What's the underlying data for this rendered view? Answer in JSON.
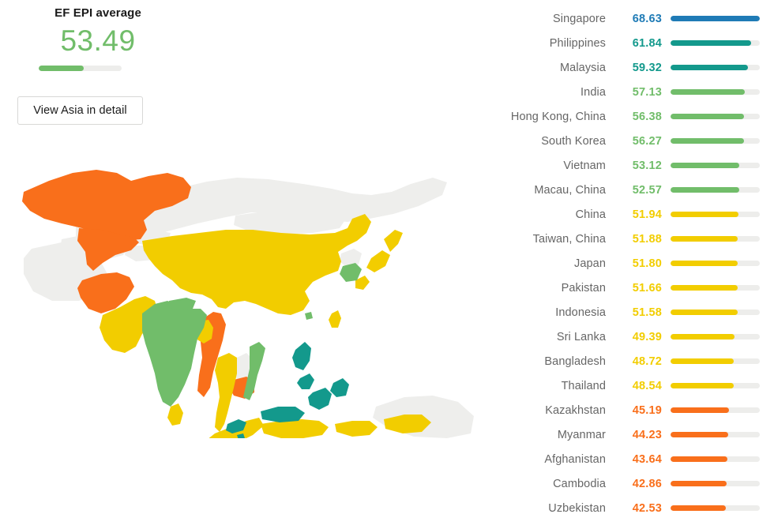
{
  "summary": {
    "title": "EF EPI average",
    "value": "53.49",
    "value_number": 53.49,
    "bar_percent": 54,
    "color": "#71bd6a"
  },
  "actions": {
    "view_detail_label": "View Asia in detail"
  },
  "palette": {
    "very_high": "#1f7bb6",
    "high": "#13998c",
    "moderate": "#71bd6a",
    "low": "#f2cd00",
    "very_low": "#f96f1b",
    "track": "#ededeb",
    "map_no_data": "#eeeeec",
    "label": "#666666"
  },
  "chart_data": {
    "type": "bar",
    "title": "EF EPI average",
    "xlabel": "",
    "ylabel": "",
    "orientation": "horizontal",
    "grid": false,
    "legend_position": "none",
    "xlim": [
      0,
      68.63
    ],
    "region": "Asia",
    "average": 53.49,
    "categories": [
      "Singapore",
      "Philippines",
      "Malaysia",
      "India",
      "Hong Kong, China",
      "South Korea",
      "Vietnam",
      "Macau, China",
      "China",
      "Taiwan, China",
      "Japan",
      "Pakistan",
      "Indonesia",
      "Sri Lanka",
      "Bangladesh",
      "Thailand",
      "Kazakhstan",
      "Myanmar",
      "Afghanistan",
      "Cambodia",
      "Uzbekistan"
    ],
    "values": [
      68.63,
      61.84,
      59.32,
      57.13,
      56.38,
      56.27,
      53.12,
      52.57,
      51.94,
      51.88,
      51.8,
      51.66,
      51.58,
      49.39,
      48.72,
      48.54,
      45.19,
      44.23,
      43.64,
      42.86,
      42.53
    ],
    "bands": [
      "very_high",
      "high",
      "high",
      "moderate",
      "moderate",
      "moderate",
      "moderate",
      "moderate",
      "low",
      "low",
      "low",
      "low",
      "low",
      "low",
      "low",
      "low",
      "very_low",
      "very_low",
      "very_low",
      "very_low",
      "very_low"
    ]
  },
  "rows": [
    {
      "country": "Singapore",
      "value": "68.63",
      "number": 68.63,
      "color": "#1f7bb6",
      "percent": 100.0
    },
    {
      "country": "Philippines",
      "value": "61.84",
      "number": 61.84,
      "color": "#13998c",
      "percent": 90.1
    },
    {
      "country": "Malaysia",
      "value": "59.32",
      "number": 59.32,
      "color": "#13998c",
      "percent": 86.4
    },
    {
      "country": "India",
      "value": "57.13",
      "number": 57.13,
      "color": "#71bd6a",
      "percent": 83.2
    },
    {
      "country": "Hong Kong, China",
      "value": "56.38",
      "number": 56.38,
      "color": "#71bd6a",
      "percent": 82.1
    },
    {
      "country": "South Korea",
      "value": "56.27",
      "number": 56.27,
      "color": "#71bd6a",
      "percent": 82.0
    },
    {
      "country": "Vietnam",
      "value": "53.12",
      "number": 53.12,
      "color": "#71bd6a",
      "percent": 77.4
    },
    {
      "country": "Macau, China",
      "value": "52.57",
      "number": 52.57,
      "color": "#71bd6a",
      "percent": 76.6
    },
    {
      "country": "China",
      "value": "51.94",
      "number": 51.94,
      "color": "#f2cd00",
      "percent": 75.7
    },
    {
      "country": "Taiwan, China",
      "value": "51.88",
      "number": 51.88,
      "color": "#f2cd00",
      "percent": 75.6
    },
    {
      "country": "Japan",
      "value": "51.80",
      "number": 51.8,
      "color": "#f2cd00",
      "percent": 75.5
    },
    {
      "country": "Pakistan",
      "value": "51.66",
      "number": 51.66,
      "color": "#f2cd00",
      "percent": 75.3
    },
    {
      "country": "Indonesia",
      "value": "51.58",
      "number": 51.58,
      "color": "#f2cd00",
      "percent": 75.2
    },
    {
      "country": "Sri Lanka",
      "value": "49.39",
      "number": 49.39,
      "color": "#f2cd00",
      "percent": 72.0
    },
    {
      "country": "Bangladesh",
      "value": "48.72",
      "number": 48.72,
      "color": "#f2cd00",
      "percent": 71.0
    },
    {
      "country": "Thailand",
      "value": "48.54",
      "number": 48.54,
      "color": "#f2cd00",
      "percent": 70.7
    },
    {
      "country": "Kazakhstan",
      "value": "45.19",
      "number": 45.19,
      "color": "#f96f1b",
      "percent": 65.8
    },
    {
      "country": "Myanmar",
      "value": "44.23",
      "number": 44.23,
      "color": "#f96f1b",
      "percent": 64.4
    },
    {
      "country": "Afghanistan",
      "value": "43.64",
      "number": 43.64,
      "color": "#f96f1b",
      "percent": 63.6
    },
    {
      "country": "Cambodia",
      "value": "42.86",
      "number": 42.86,
      "color": "#f96f1b",
      "percent": 62.4
    },
    {
      "country": "Uzbekistan",
      "value": "42.53",
      "number": 42.53,
      "color": "#f96f1b",
      "percent": 62.0
    }
  ],
  "map": {
    "name": "asia-choropleth-map",
    "regions": [
      {
        "name": "kazakhstan",
        "color": "#f96f1b"
      },
      {
        "name": "uzbekistan",
        "color": "#f96f1b"
      },
      {
        "name": "afghanistan",
        "color": "#f96f1b"
      },
      {
        "name": "pakistan",
        "color": "#f2cd00"
      },
      {
        "name": "india",
        "color": "#71bd6a"
      },
      {
        "name": "sri-lanka",
        "color": "#f2cd00"
      },
      {
        "name": "bangladesh",
        "color": "#f2cd00"
      },
      {
        "name": "nepal",
        "color": "#71bd6a"
      },
      {
        "name": "china",
        "color": "#f2cd00"
      },
      {
        "name": "mongolia",
        "color": "#eeeeec"
      },
      {
        "name": "russia",
        "color": "#eeeeec"
      },
      {
        "name": "japan",
        "color": "#f2cd00"
      },
      {
        "name": "south-korea",
        "color": "#71bd6a"
      },
      {
        "name": "north-korea",
        "color": "#eeeeec"
      },
      {
        "name": "taiwan",
        "color": "#f2cd00"
      },
      {
        "name": "hong-kong",
        "color": "#71bd6a"
      },
      {
        "name": "myanmar",
        "color": "#f96f1b"
      },
      {
        "name": "thailand",
        "color": "#f2cd00"
      },
      {
        "name": "laos",
        "color": "#eeeeec"
      },
      {
        "name": "cambodia",
        "color": "#f96f1b"
      },
      {
        "name": "vietnam",
        "color": "#71bd6a"
      },
      {
        "name": "malaysia",
        "color": "#13998c"
      },
      {
        "name": "singapore",
        "color": "#13998c"
      },
      {
        "name": "indonesia",
        "color": "#f2cd00"
      },
      {
        "name": "philippines",
        "color": "#13998c"
      },
      {
        "name": "australia",
        "color": "#eeeeec"
      },
      {
        "name": "iran",
        "color": "#eeeeec"
      },
      {
        "name": "turkmenistan",
        "color": "#eeeeec"
      },
      {
        "name": "kyrgyzstan",
        "color": "#eeeeec"
      },
      {
        "name": "tajikistan",
        "color": "#eeeeec"
      }
    ]
  }
}
